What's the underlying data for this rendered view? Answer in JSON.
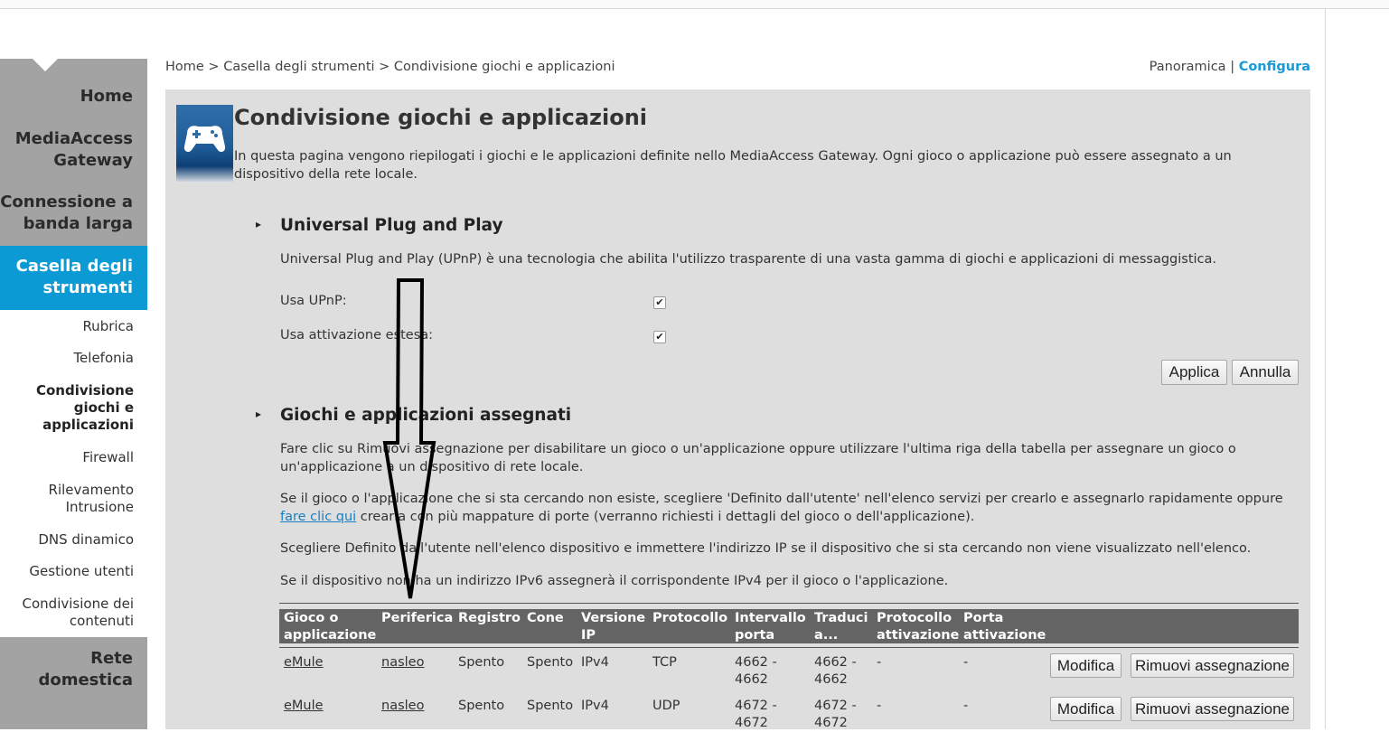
{
  "sidebar": {
    "main_items": [
      {
        "label": "Home"
      },
      {
        "label": "MediaAccess Gateway",
        "lines": [
          "MediaAccess",
          "Gateway"
        ]
      },
      {
        "label": "Connessione a banda larga",
        "lines": [
          "Connessione a",
          "banda larga"
        ]
      },
      {
        "label": "Casella degli strumenti",
        "lines": [
          "Casella degli",
          "strumenti"
        ]
      },
      {
        "label": "Rete domestica",
        "lines": [
          "Rete",
          "domestica"
        ]
      }
    ],
    "sub_items": [
      {
        "label": "Rubrica"
      },
      {
        "label": "Telefonia"
      },
      {
        "label": "Condivisione giochi e applicazioni",
        "lines": [
          "Condivisione",
          "giochi e",
          "applicazioni"
        ]
      },
      {
        "label": "Firewall"
      },
      {
        "label": "Rilevamento Intrusione",
        "lines": [
          "Rilevamento",
          "Intrusione"
        ]
      },
      {
        "label": "DNS dinamico"
      },
      {
        "label": "Gestione utenti"
      },
      {
        "label": "Condivisione dei contenuti",
        "lines": [
          "Condivisione dei",
          "contenuti"
        ]
      }
    ]
  },
  "breadcrumb": "Home > Casella degli strumenti > Condivisione giochi e applicazioni",
  "view_links": {
    "overview": "Panoramica",
    "separator": "|",
    "configure": "Configura"
  },
  "page": {
    "icon": "gamepad-icon",
    "title": "Condivisione giochi e applicazioni",
    "intro": "In questa pagina vengono riepilogati i giochi e le applicazioni definite nello MediaAccess Gateway. Ogni gioco o applicazione può essere assegnato a un dispositivo della rete locale."
  },
  "upnp": {
    "arrow": "▸",
    "title": "Universal Plug and Play",
    "description": "Universal Plug and Play (UPnP) è una tecnologia che abilita l'utilizzo trasparente di una vasta gamma di giochi e applicazioni di messaggistica.",
    "use_upnp_label": "Usa UPnP:",
    "use_upnp_checked": true,
    "extended_label": "Usa attivazione estesa:",
    "extended_checked": true,
    "check_mark": "✔",
    "apply": "Applica",
    "cancel": "Annulla"
  },
  "assigned": {
    "arrow": "▸",
    "title": "Giochi e applicazioni assegnati",
    "p1": "Fare clic su Rimuovi assegnazione per disabilitare un gioco o un'applicazione oppure utilizzare l'ultima riga della tabella per assegnare un gioco o un'applicazione a un dispositivo di rete locale.",
    "p2_before": "Se il gioco o l'applicazione che si sta cercando non esiste, scegliere 'Definito dall'utente' nell'elenco servizi per crearlo e assegnarlo rapidamente oppure ",
    "p2_link": "fare clic qui",
    "p2_after": " crearla con più mappature di porte (verranno richiesti i dettagli del gioco o dell'applicazione).",
    "p3": "Scegliere Definito dall'utente nell'elenco dispositivo e immettere l'indirizzo IP se il dispositivo che si sta cercando non viene visualizzato nell'elenco.",
    "p4": "Se il dispositivo non ha un indirizzo IPv6 assegnerà il corrispondente IPv4 per il gioco o l'applicazione.",
    "columns": [
      [
        "Gioco o",
        "applicazione"
      ],
      [
        "Periferica"
      ],
      [
        "Registro"
      ],
      [
        "Cone"
      ],
      [
        "Versione",
        "IP"
      ],
      [
        "Protocollo"
      ],
      [
        "Intervallo",
        "porta"
      ],
      [
        "Traduci",
        "a..."
      ],
      [
        "Protocollo",
        "attivazione"
      ],
      [
        "Porta",
        "attivazione"
      ]
    ],
    "rows": [
      {
        "game": "eMule",
        "device": "nasleo",
        "log": "Spento",
        "cone": "Spento",
        "ip": "IPv4",
        "protocol": "TCP",
        "range": [
          "4662 -",
          "4662"
        ],
        "translate": [
          "4662 -",
          "4662"
        ],
        "trig_proto": "-",
        "trig_port": "-",
        "edit": "Modifica",
        "remove": "Rimuovi assegnazione"
      },
      {
        "game": "eMule",
        "device": "nasleo",
        "log": "Spento",
        "cone": "Spento",
        "ip": "IPv4",
        "protocol": "UDP",
        "range": [
          "4672 -",
          "4672"
        ],
        "translate": [
          "4672 -",
          "4672"
        ],
        "trig_proto": "-",
        "trig_port": "-",
        "edit": "Modifica",
        "remove": "Rimuovi assegnazione"
      }
    ]
  },
  "annotation": {
    "type": "hand-drawn-arrow-down",
    "color": "#000000"
  }
}
